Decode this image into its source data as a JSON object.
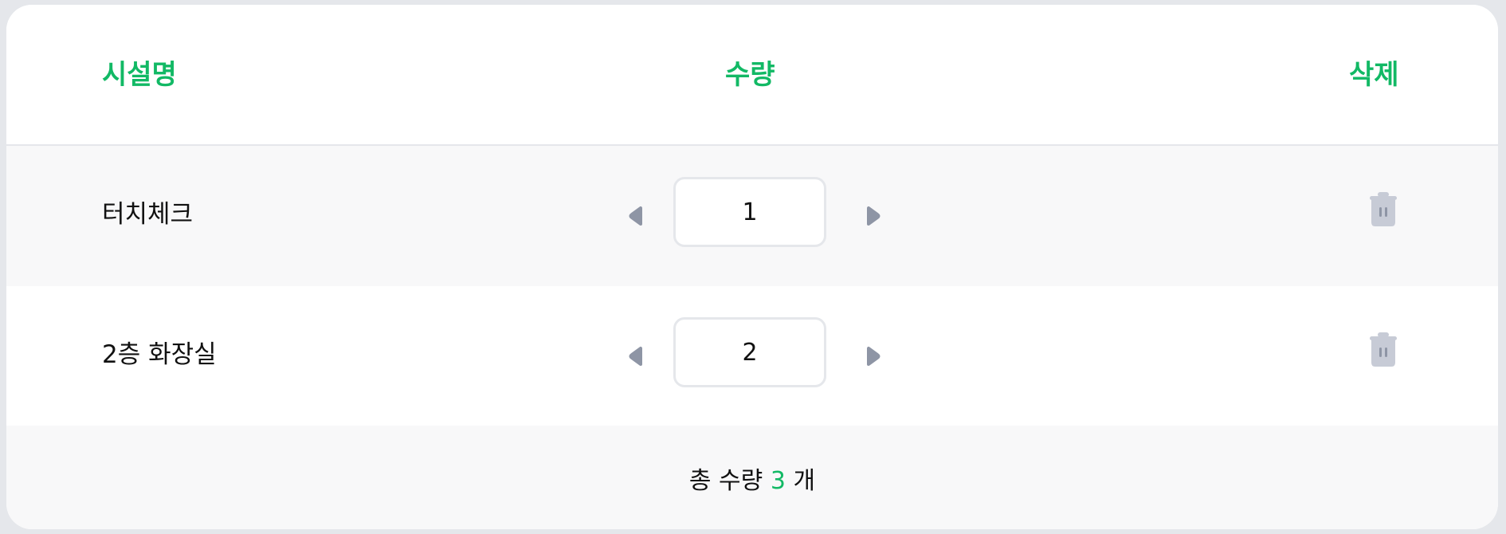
{
  "table": {
    "headers": {
      "name": "시설명",
      "quantity": "수량",
      "delete": "삭제"
    },
    "rows": [
      {
        "name": "터치체크",
        "quantity": "1"
      },
      {
        "name": "2층 화장실",
        "quantity": "2"
      }
    ]
  },
  "footer": {
    "prefix": "총 수량",
    "total": "3",
    "suffix": "개"
  },
  "icons": {
    "decrement": "caret-left-icon",
    "increment": "caret-right-icon",
    "delete": "trash-icon"
  },
  "colors": {
    "accent": "#12b965",
    "icon_gray": "#8e95a5",
    "trash_gray": "#c7cbd6",
    "row_alt_bg": "#f8f8f9",
    "border": "#e5e7eb"
  }
}
